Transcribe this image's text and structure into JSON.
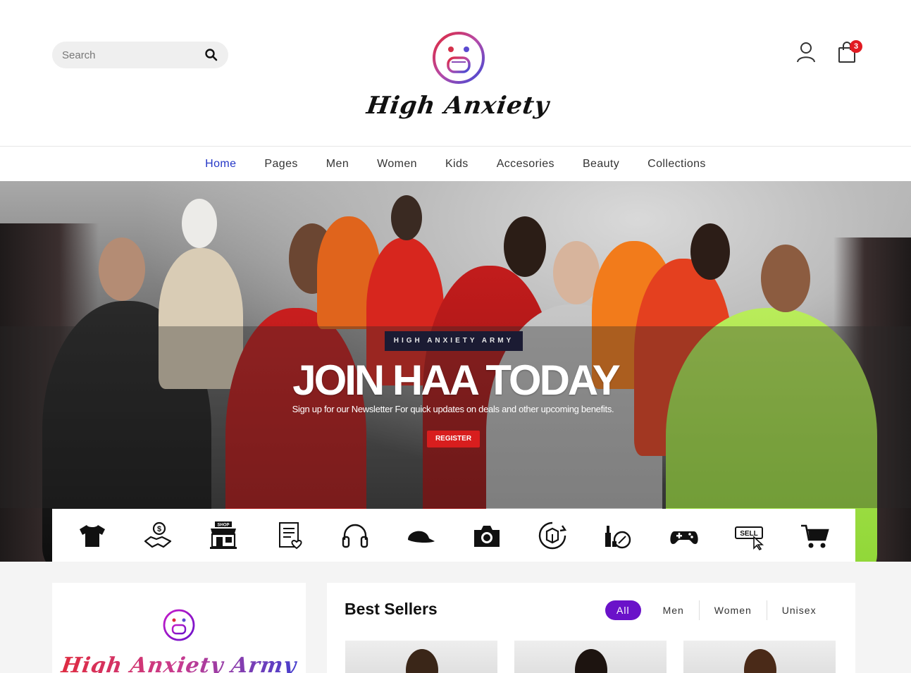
{
  "header": {
    "search_placeholder": "Search",
    "brand_name": "High Anxiety",
    "cart_count": "3"
  },
  "nav": {
    "items": [
      "Home",
      "Pages",
      "Men",
      "Women",
      "Kids",
      "Accesories",
      "Beauty",
      "Collections"
    ],
    "active": "Home"
  },
  "hero": {
    "tag": "HIGH ANXIETY ARMY",
    "title": "JOIN HAA TODAY",
    "subtitle": "Sign up for our Newsletter For quick updates on deals and other upcoming benefits.",
    "button": "REGISTER"
  },
  "categories": [
    {
      "icon": "tshirt-icon"
    },
    {
      "icon": "money-handshake-icon"
    },
    {
      "icon": "shop-storefront-icon",
      "label": "SHOP"
    },
    {
      "icon": "wishlist-document-icon"
    },
    {
      "icon": "headphones-icon"
    },
    {
      "icon": "cap-icon"
    },
    {
      "icon": "camera-icon"
    },
    {
      "icon": "box-return-icon"
    },
    {
      "icon": "cosmetics-icon"
    },
    {
      "icon": "gamepad-icon"
    },
    {
      "icon": "sell-tag-icon",
      "label": "SELL"
    },
    {
      "icon": "shopping-cart-icon"
    }
  ],
  "promo": {
    "brand": "High Anxiety Army"
  },
  "best_sellers": {
    "title": "Best Sellers",
    "tabs": [
      "All",
      "Men",
      "Women",
      "Unisex"
    ],
    "active_tab": "All"
  },
  "colors": {
    "nav_active": "#2436c6",
    "cart_badge": "#e11b22",
    "register_button": "#d81e1e",
    "tab_active": "#6a12c9",
    "hero_tag_bg": "#1b1b33"
  }
}
